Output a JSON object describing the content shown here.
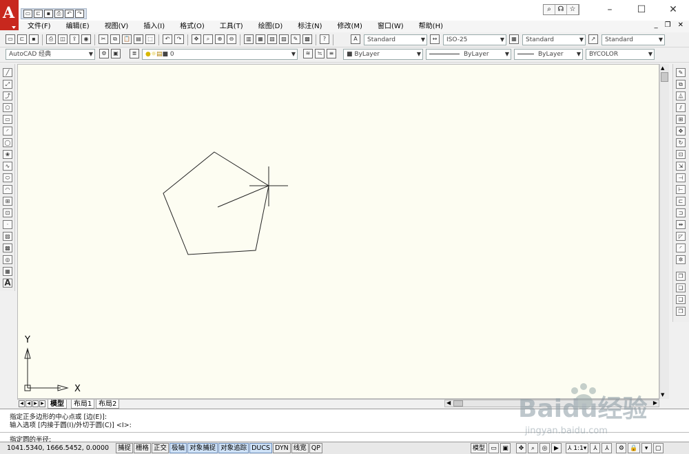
{
  "app": {
    "logo_letter": "A"
  },
  "quick_access": {
    "icons": [
      "new-icon",
      "open-icon",
      "save-icon",
      "print-icon",
      "undo-icon",
      "redo-icon"
    ]
  },
  "menubar": {
    "items": [
      "文件(F)",
      "编辑(E)",
      "视图(V)",
      "插入(I)",
      "格式(O)",
      "工具(T)",
      "绘图(D)",
      "标注(N)",
      "修改(M)",
      "窗口(W)",
      "帮助(H)"
    ]
  },
  "styles": {
    "text_style": "Standard",
    "dim_style": "ISO-25",
    "table_style": "Standard",
    "multileader_style": "Standard"
  },
  "workspace": {
    "name": "AutoCAD 经典"
  },
  "layer": {
    "name": "0"
  },
  "properties": {
    "color": "ByLayer",
    "linetype": "ByLayer",
    "lineweight": "ByLayer",
    "plotstyle": "BYCOLOR"
  },
  "ucs": {
    "x_label": "X",
    "y_label": "Y"
  },
  "tabs": {
    "model": "模型",
    "layout1": "布局1",
    "layout2": "布局2"
  },
  "command": {
    "line1": "指定正多边形的中心点或 [边(E)]:",
    "line2": "输入选项 [内接于圆(I)/外切于圆(C)] <I>:",
    "prompt": "指定圆的半径:"
  },
  "status": {
    "coords": "1041.5340, 1666.5452, 0.0000",
    "modes": [
      {
        "label": "捕捉",
        "on": false
      },
      {
        "label": "栅格",
        "on": false
      },
      {
        "label": "正交",
        "on": false
      },
      {
        "label": "极轴",
        "on": true
      },
      {
        "label": "对象捕捉",
        "on": true
      },
      {
        "label": "对象追踪",
        "on": true
      },
      {
        "label": "DUCS",
        "on": true
      },
      {
        "label": "DYN",
        "on": false
      },
      {
        "label": "线宽",
        "on": false
      },
      {
        "label": "QP",
        "on": false
      }
    ],
    "model_label": "模型",
    "annotation_scale": "1:1"
  },
  "watermark": {
    "brand": "Baidu经验",
    "url": "jingyan.baidu.com"
  },
  "colors": {
    "canvas": "#fdfdf2",
    "app_red": "#c8281e",
    "mode_on": "#cfe2f7"
  }
}
